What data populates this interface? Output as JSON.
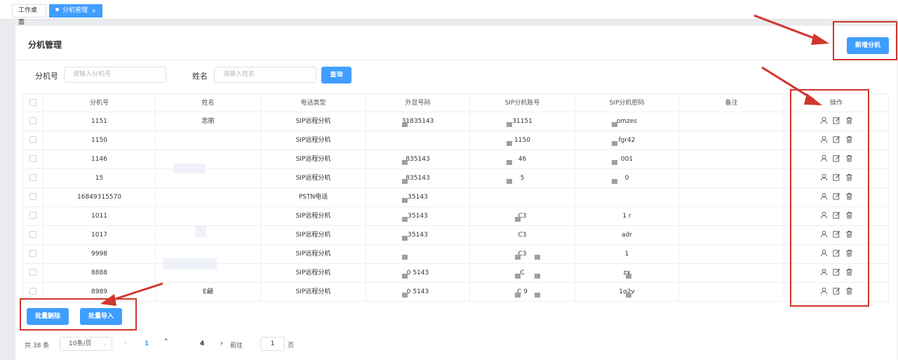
{
  "tabs": [
    {
      "label": "工作桌面"
    },
    {
      "label": "分机管理",
      "close": "×"
    }
  ],
  "page": {
    "title": "分机管理",
    "add_button": "新增分机"
  },
  "filters": {
    "ext_label": "分机号",
    "ext_placeholder": "请输入分机号",
    "name_label": "姓名",
    "name_placeholder": "请输入姓名",
    "query_button": "查询"
  },
  "table": {
    "headers": [
      "分机号",
      "姓名",
      "电话类型",
      "外显号码",
      "SIP分机账号",
      "SIP分机密码",
      "备注",
      "操作"
    ],
    "rows": [
      {
        "ext": "1151",
        "name": "忠丽",
        "type": "SIP远程分机",
        "display": "31835143",
        "sip_acc": "31151",
        "sip_pwd": "omzes"
      },
      {
        "ext": "1150",
        "name": "",
        "type": "SIP远程分机",
        "display": "",
        "sip_acc": "1150",
        "sip_pwd": "fgr42"
      },
      {
        "ext": "1146",
        "name": "",
        "type": "SIP远程分机",
        "display": "835143",
        "sip_acc": "46",
        "sip_pwd": "001"
      },
      {
        "ext": "15",
        "name": "",
        "type": "SIP远程分机",
        "display": "835143",
        "sip_acc": "5",
        "sip_pwd": "0"
      },
      {
        "ext": "16849315570",
        "name": "",
        "type": "PSTN电话",
        "display": "35143",
        "sip_acc": "",
        "sip_pwd": ""
      },
      {
        "ext": "1011",
        "name": "",
        "type": "SIP远程分机",
        "display": "35143",
        "sip_acc": "C3",
        "sip_pwd": "1 r"
      },
      {
        "ext": "1017",
        "name": "",
        "type": "SIP远程分机",
        "display": "35143",
        "sip_acc": "C3",
        "sip_pwd": "adr"
      },
      {
        "ext": "9998",
        "name": "",
        "type": "SIP远程分机",
        "display": "",
        "sip_acc": "C3",
        "sip_pwd": "1"
      },
      {
        "ext": "8888",
        "name": "",
        "type": "SIP远程分机",
        "display": "0 5143",
        "sip_acc": "C",
        "sip_pwd": "zx"
      },
      {
        "ext": "8989",
        "name": "E翩",
        "type": "SIP远程分机",
        "display": "0 5143",
        "sip_acc": "C 9",
        "sip_pwd": "1q2v"
      }
    ]
  },
  "batch": {
    "delete_button": "批量删除",
    "import_button": "批量导入"
  },
  "pagination": {
    "total": "共 38 条",
    "page_size": "10条/页",
    "pages": [
      "1",
      "4"
    ],
    "goto_label": "前往",
    "goto_value": "1",
    "goto_unit": "页"
  },
  "colors": {
    "primary": "#409eff",
    "annotation": "#d1352b"
  }
}
